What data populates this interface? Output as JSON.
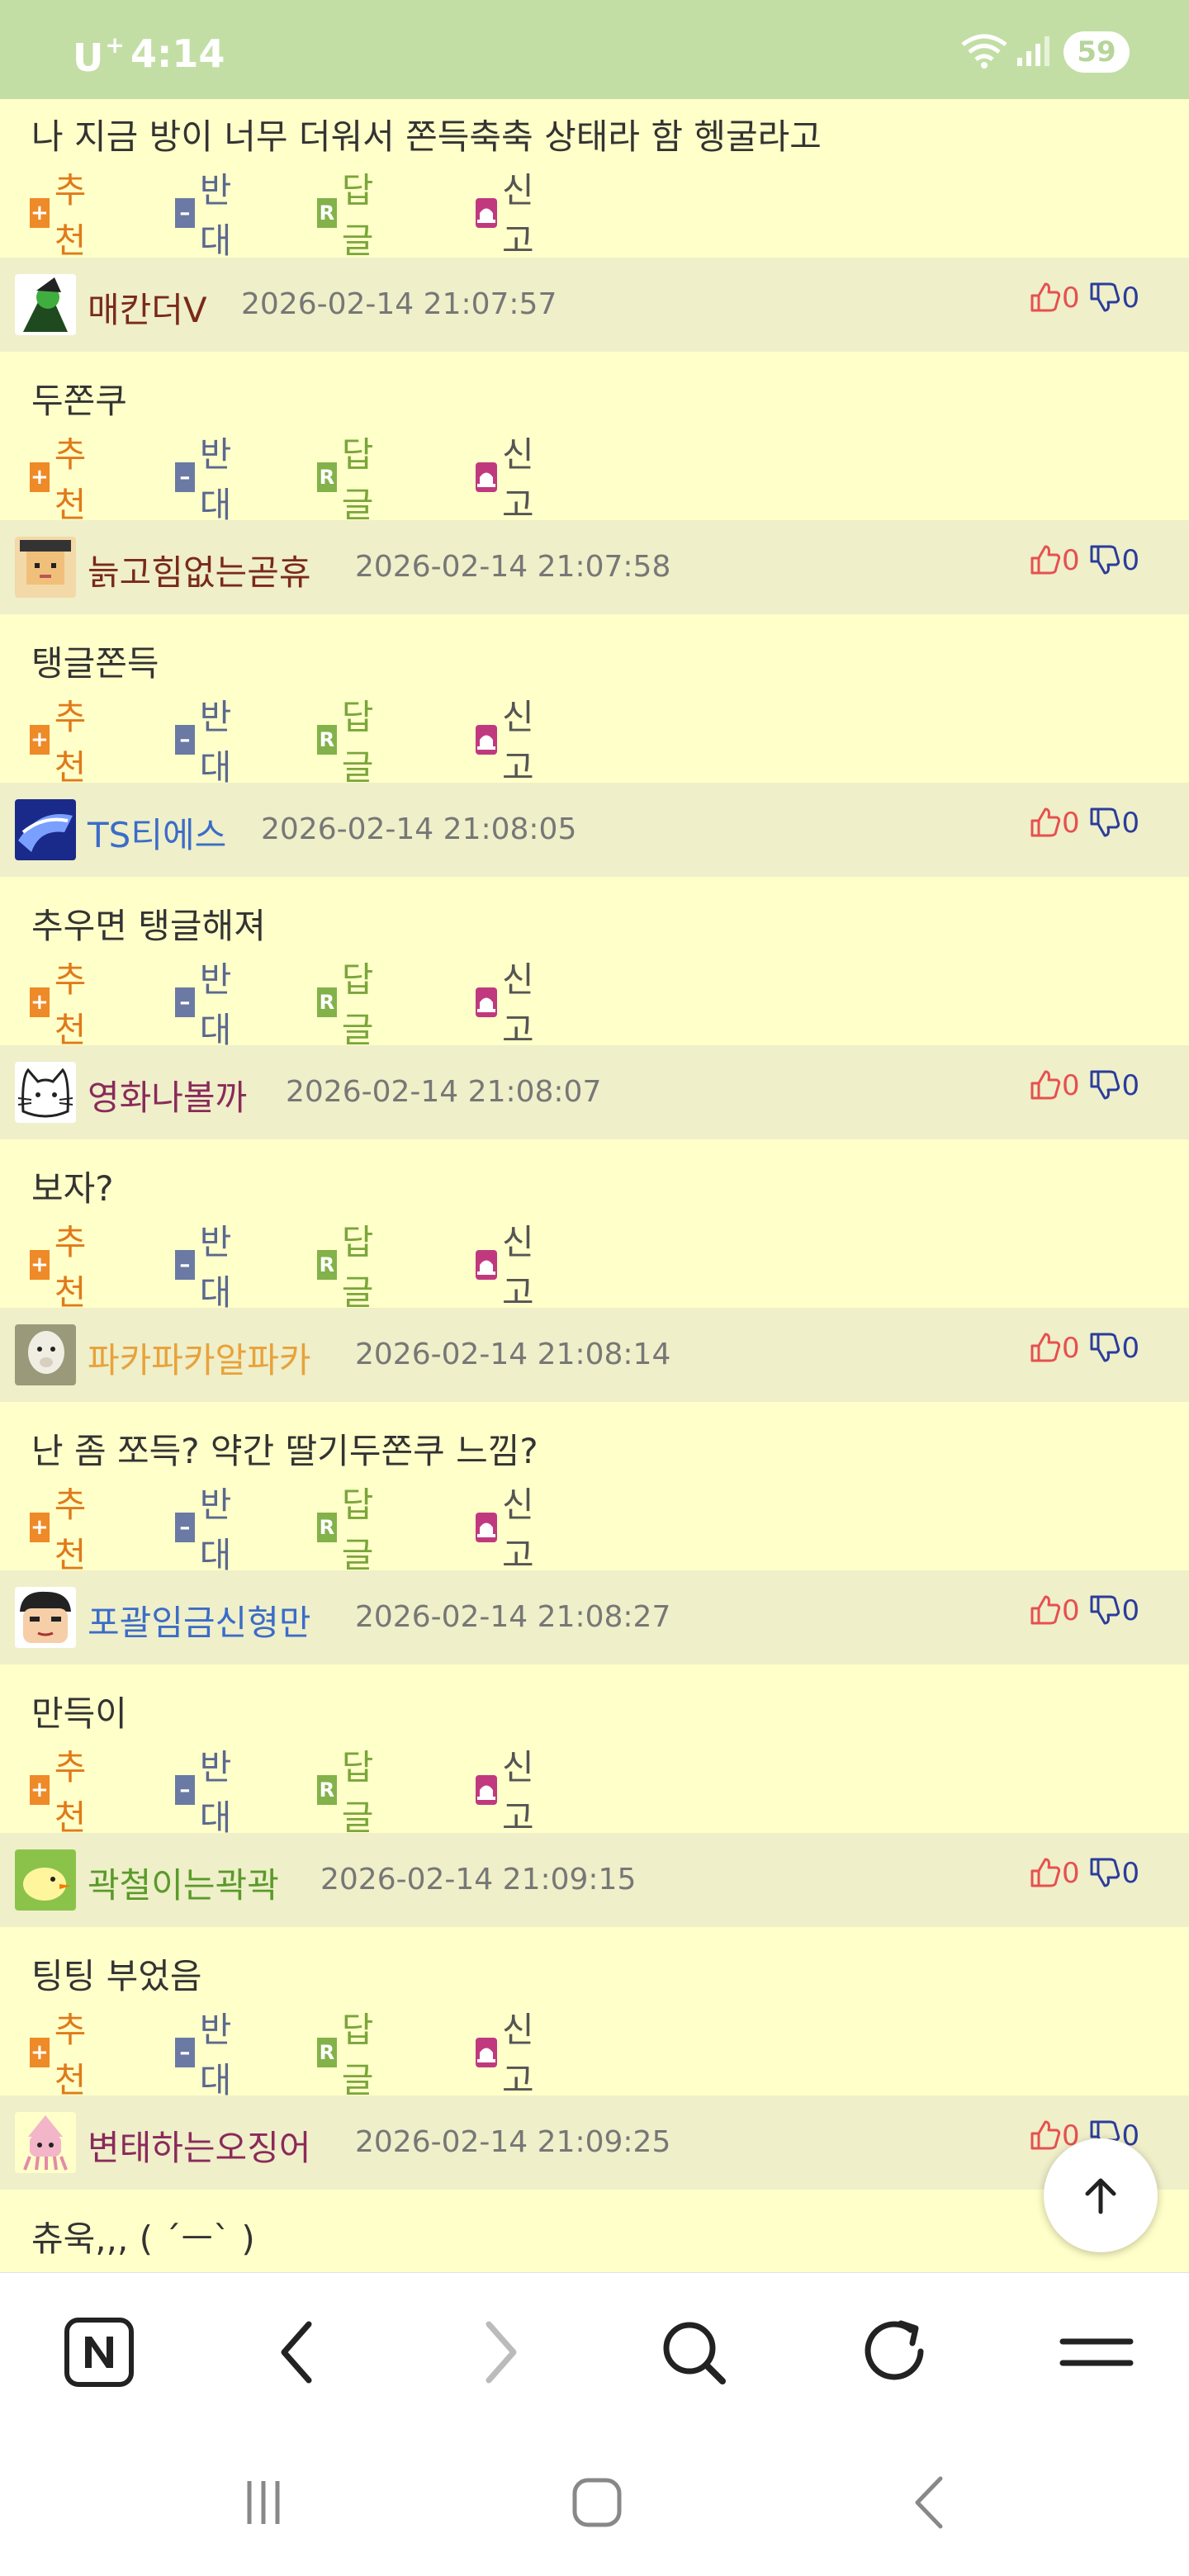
{
  "status_bar": {
    "carrier": "U",
    "carrier_sup": "+",
    "time": "4:14",
    "battery": "59"
  },
  "actions": {
    "recommend": "추천",
    "oppose": "반대",
    "reply": "답글",
    "report": "신고",
    "reply_icon_letter": "R"
  },
  "first_comment_text": "나 지금 방이 너무 더워서 쫀득축축 상태라 함 헹굴라고",
  "comments": [
    {
      "nick": "매칸더V",
      "nick_color": "#7a2a1a",
      "date": "2026-02-14 21:07:57",
      "up": "0",
      "down": "0",
      "text": "두쫀쿠",
      "avatar": "witch-avatar"
    },
    {
      "nick": "늙고힘없는곧휴",
      "nick_color": "#7a2a1a",
      "date": "2026-02-14 21:07:58",
      "up": "0",
      "down": "0",
      "text": "탱글쫀득",
      "avatar": "hat-avatar"
    },
    {
      "nick": "TS티에스",
      "nick_color": "#3b6cc8",
      "date": "2026-02-14 21:08:05",
      "up": "0",
      "down": "0",
      "text": "추우면 탱글해져",
      "avatar": "blue-avatar"
    },
    {
      "nick": "영화나볼까",
      "nick_color": "#8a2a5a",
      "date": "2026-02-14 21:08:07",
      "up": "0",
      "down": "0",
      "text": "보자?",
      "avatar": "cat-avatar"
    },
    {
      "nick": "파카파카알파카",
      "nick_color": "#e8a23a",
      "date": "2026-02-14 21:08:14",
      "up": "0",
      "down": "0",
      "text": "난 좀 쪼득? 약간 딸기두쫀쿠 느낌?",
      "avatar": "alpaca-avatar"
    },
    {
      "nick": "포괄임금신형만",
      "nick_color": "#3b6cc8",
      "date": "2026-02-14 21:08:27",
      "up": "0",
      "down": "0",
      "text": "만득이",
      "avatar": "shin-avatar"
    },
    {
      "nick": "곽철이는곽곽",
      "nick_color": "#5a9a2a",
      "date": "2026-02-14 21:09:15",
      "up": "0",
      "down": "0",
      "text": "팅팅 부었음",
      "avatar": "duck-avatar"
    },
    {
      "nick": "변태하는오징어",
      "nick_color": "#8a2a5a",
      "date": "2026-02-14 21:09:25",
      "up": "0",
      "down": "0",
      "text": "츄욱,,, (  ´ㅡ` )",
      "avatar": "squid-avatar"
    }
  ],
  "colors": {
    "background": "#ffffc9",
    "author_bar": "#efefc9",
    "status_bar": "#c3dea4",
    "recommend": "#ee8a27",
    "oppose": "#6a7aa4",
    "reply": "#83b14a",
    "report": "#c0397f"
  }
}
